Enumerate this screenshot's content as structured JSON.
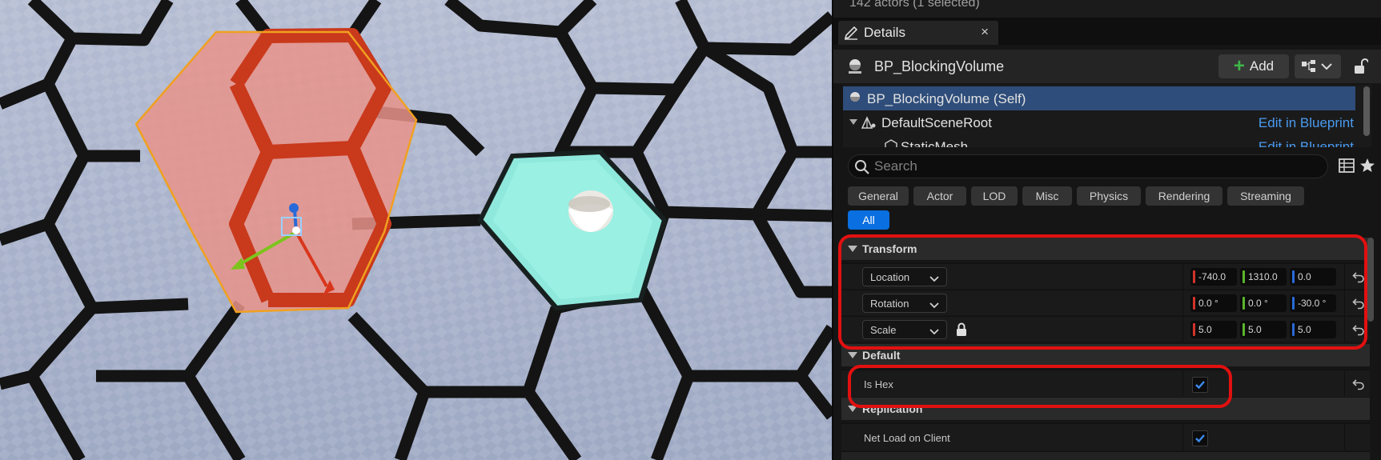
{
  "actors_status": "142 actors (1 selected)",
  "tab": {
    "label": "Details",
    "close": "×",
    "icon": "details-pencil-icon"
  },
  "actor": {
    "name": "BP_BlockingVolume",
    "icon": "actor-sphere-icon"
  },
  "toolbar": {
    "add_label": "Add",
    "add_icon": "plus-icon",
    "blueprint_icon": "blueprint-dropdown-icon",
    "lock_icon": "lock-open-icon"
  },
  "components": [
    {
      "label": "BP_BlockingVolume (Self)",
      "selected": true
    },
    {
      "label": "DefaultSceneRoot",
      "edit": "Edit in Blueprint"
    },
    {
      "label": "StaticMesh",
      "edit": "Edit in Blueprint"
    }
  ],
  "search": {
    "placeholder": "Search"
  },
  "filters": [
    "General",
    "Actor",
    "LOD",
    "Misc",
    "Physics",
    "Rendering",
    "Streaming",
    "All"
  ],
  "active_filter": "All",
  "transform": {
    "title": "Transform",
    "location": {
      "label": "Location",
      "x": "-740.0",
      "y": "1310.0",
      "z": "0.0"
    },
    "rotation": {
      "label": "Rotation",
      "x": "0.0 °",
      "y": "0.0 °",
      "z": "-30.0 °"
    },
    "scale": {
      "label": "Scale",
      "x": "5.0",
      "y": "5.0",
      "z": "5.0"
    }
  },
  "default": {
    "title": "Default",
    "is_hex": {
      "label": "Is Hex",
      "checked": true
    }
  },
  "replication": {
    "title": "Replication",
    "net_load": {
      "label": "Net Load on Client",
      "checked": true
    }
  },
  "colors": {
    "highlight": "#e21010",
    "accent": "#0a6fe0",
    "selected_row": "#2e4d7a",
    "link": "#4a9bf0"
  }
}
